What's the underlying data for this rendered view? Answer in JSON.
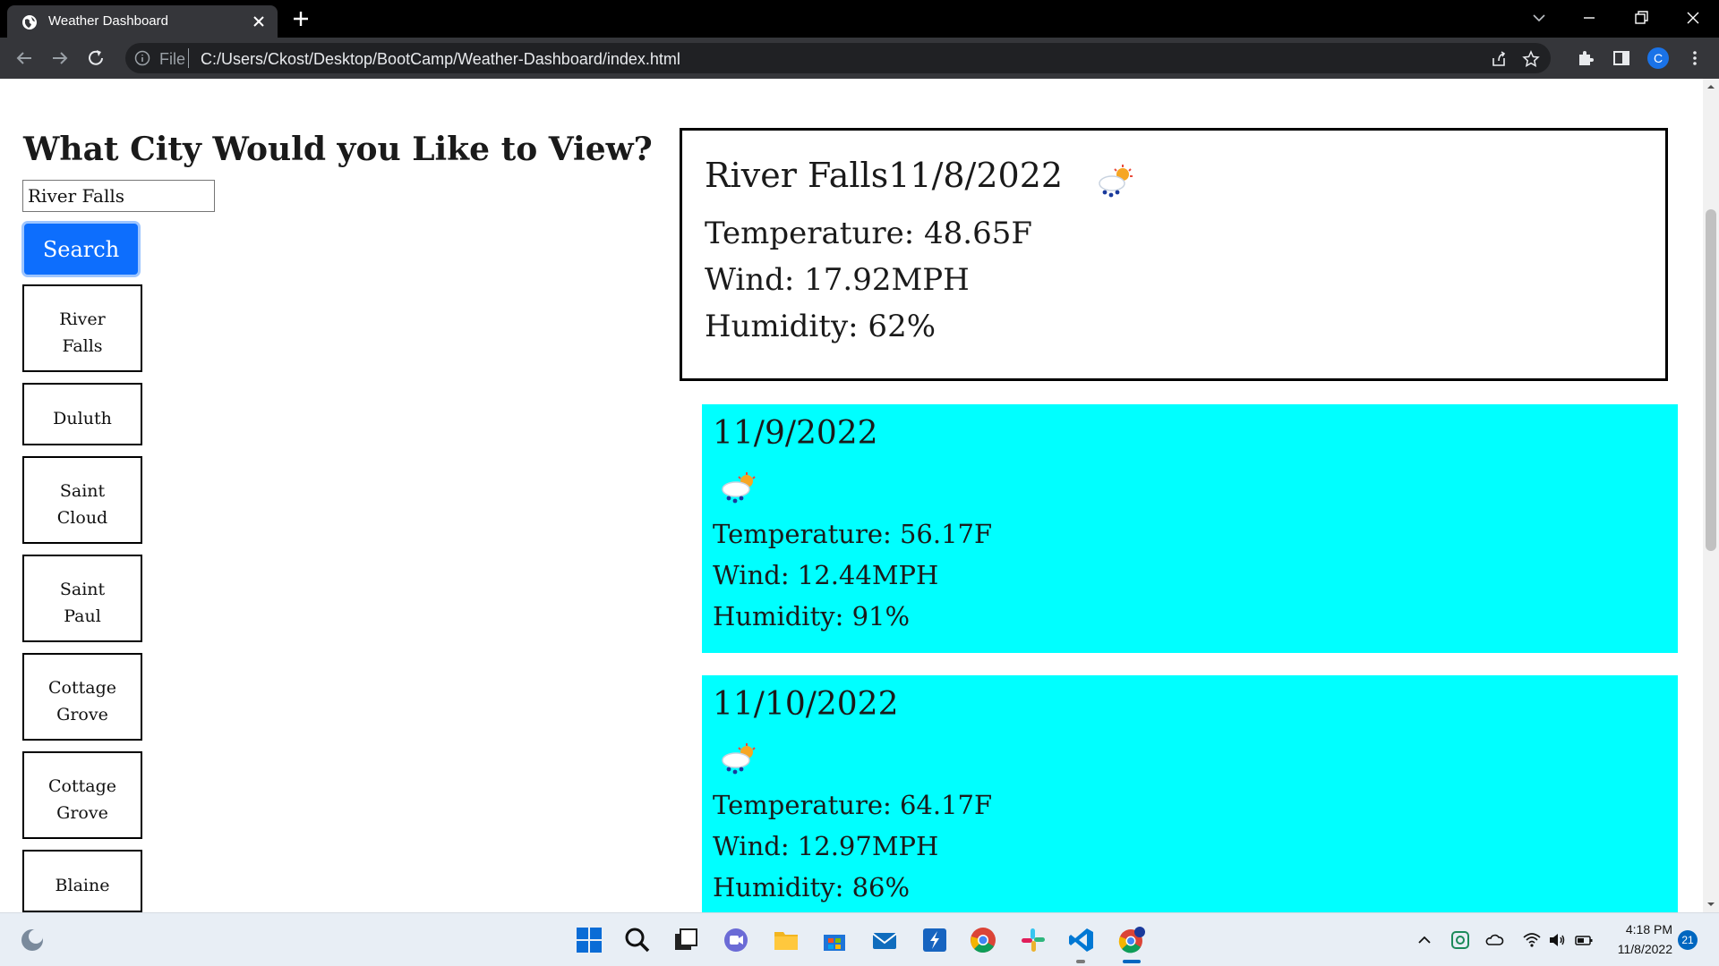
{
  "browser": {
    "tab_title": "Weather Dashboard",
    "url_scheme": "File",
    "url": "C:/Users/Ckost/Desktop/BootCamp/Weather-Dashboard/index.html",
    "profile_initial": "C"
  },
  "page": {
    "heading": "What City Would you Like to View?",
    "search_value": "River Falls",
    "search_button": "Search",
    "history": [
      {
        "line1": "River",
        "line2": "Falls"
      },
      {
        "line1": "Duluth",
        "line2": ""
      },
      {
        "line1": "Saint",
        "line2": "Cloud"
      },
      {
        "line1": "Saint",
        "line2": "Paul"
      },
      {
        "line1": "Cottage",
        "line2": "Grove"
      },
      {
        "line1": "Cottage",
        "line2": "Grove"
      },
      {
        "line1": "Blaine",
        "line2": ""
      }
    ],
    "current": {
      "title": "River Falls11/8/2022",
      "temperature": "Temperature: 48.65F",
      "wind": "Wind: 17.92MPH",
      "humidity": "Humidity: 62%"
    },
    "forecast": [
      {
        "date": "11/9/2022",
        "temperature": "Temperature: 56.17F",
        "wind": "Wind: 12.44MPH",
        "humidity": "Humidity: 91%"
      },
      {
        "date": "11/10/2022",
        "temperature": "Temperature: 64.17F",
        "wind": "Wind: 12.97MPH",
        "humidity": "Humidity: 86%"
      }
    ]
  },
  "taskbar": {
    "time": "4:18 PM",
    "date": "11/8/2022",
    "notification_count": "21"
  },
  "colors": {
    "forecast_bg": "#00ffff",
    "search_button": "#0d6efd",
    "browser_tabbar": "#000000",
    "browser_toolbar": "#35363a"
  },
  "icons": [
    "globe-icon",
    "close-icon",
    "plus-icon",
    "back-arrow-icon",
    "forward-arrow-icon",
    "reload-icon",
    "info-icon",
    "share-icon",
    "star-icon",
    "puzzle-icon",
    "sidepanel-icon",
    "kebab-menu-icon",
    "weather-rain-sun-icon"
  ]
}
